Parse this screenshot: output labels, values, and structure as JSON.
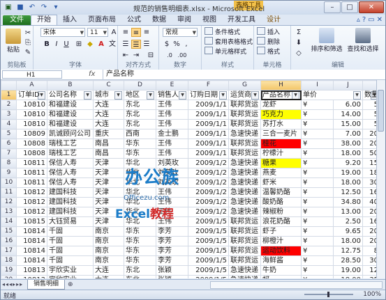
{
  "window": {
    "title": "规范的销售明细表.xlsx - Microsoft Excel",
    "context_tab_group": "表格工具"
  },
  "ribbon_tabs": [
    "文件",
    "开始",
    "插入",
    "页面布局",
    "公式",
    "数据",
    "审阅",
    "视图",
    "开发工具",
    "设计"
  ],
  "ribbon": {
    "clipboard": {
      "paste": "粘贴",
      "group": "剪贴板"
    },
    "font": {
      "name": "宋体",
      "size": "11",
      "group": "字体"
    },
    "alignment": {
      "group": "对齐方式"
    },
    "number": {
      "format": "常规",
      "group": "数字"
    },
    "styles": {
      "cond": "条件格式",
      "table": "套用表格格式",
      "cell": "单元格样式",
      "group": "样式"
    },
    "cells": {
      "insert": "插入",
      "delete": "删除",
      "format": "格式",
      "group": "单元格"
    },
    "editing": {
      "sort": "排序和筛选",
      "find": "查找和选择",
      "group": "编辑"
    }
  },
  "formula_bar": {
    "name_box": "H1",
    "fx": "fx",
    "content": "产品名称"
  },
  "columns": [
    "A",
    "B",
    "C",
    "D",
    "E",
    "F",
    "G",
    "H",
    "I",
    "J"
  ],
  "headers": [
    "订单ID",
    "公司名称",
    "城市",
    "地区",
    "销售人",
    "订购日期",
    "运货商",
    "产品名称",
    "单价",
    "数量"
  ],
  "rows": [
    [
      "10810",
      "和福建设",
      "大连",
      "东北",
      "王伟",
      "2009/1/1",
      "联邦货运",
      "龙虾",
      "¥",
      "6.00",
      "5",
      ""
    ],
    [
      "10810",
      "和福建设",
      "大连",
      "东北",
      "王伟",
      "2009/1/1",
      "联邦货运",
      "巧克力",
      "¥",
      "14.00",
      "5",
      "yellow"
    ],
    [
      "10810",
      "和福建设",
      "大连",
      "东北",
      "王伟",
      "2009/1/1",
      "联邦货运",
      "苏打水",
      "¥",
      "15.00",
      "5",
      ""
    ],
    [
      "10809",
      "凯诚顾问公司",
      "重庆",
      "西南",
      "金士鹏",
      "2009/1/1",
      "急速快递",
      "三合一麦片",
      "¥",
      "7.00",
      "20",
      ""
    ],
    [
      "10808",
      "瑞栈工艺",
      "南昌",
      "华东",
      "王伟",
      "2009/1/1",
      "联邦货运",
      "桂花",
      "¥",
      "38.00",
      "20",
      "red"
    ],
    [
      "10808",
      "瑞栈工艺",
      "南昌",
      "华东",
      "王伟",
      "2009/1/1",
      "联邦货运",
      "柠檬汁",
      "¥",
      "18.00",
      "50",
      ""
    ],
    [
      "10811",
      "保信人寿",
      "天津",
      "华北",
      "刘英玫",
      "2009/1/2",
      "急速快递",
      "糖果",
      "¥",
      "9.20",
      "15",
      "yellow"
    ],
    [
      "10811",
      "保信人寿",
      "天津",
      "华北",
      "刘英玫",
      "2009/1/2",
      "急速快递",
      "燕麦",
      "¥",
      "19.00",
      "18",
      ""
    ],
    [
      "10811",
      "保信人寿",
      "天津",
      "华北",
      "刘英玫",
      "2009/1/2",
      "急速快递",
      "虾米",
      "¥",
      "18.00",
      "30",
      ""
    ],
    [
      "10812",
      "建国科技",
      "天津",
      "华北",
      "王伟",
      "2009/1/2",
      "急速快递",
      "温馨奶酪",
      "¥",
      "12.50",
      "16",
      ""
    ],
    [
      "10812",
      "建国科技",
      "天津",
      "华北",
      "王伟",
      "2009/1/2",
      "急速快递",
      "酸奶酪",
      "¥",
      "34.80",
      "40",
      ""
    ],
    [
      "10812",
      "建国科技",
      "天津",
      "华北",
      "王伟",
      "2009/1/2",
      "急速快递",
      "辣椒粉",
      "¥",
      "13.00",
      "20",
      ""
    ],
    [
      "10815",
      "大钰贸易",
      "天津",
      "华北",
      "王伟",
      "2009/1/5",
      "联邦货运",
      "浪花奶酪",
      "¥",
      "2.50",
      "16",
      ""
    ],
    [
      "10814",
      "千固",
      "南京",
      "华东",
      "李芳",
      "2009/1/5",
      "联邦货运",
      "虾子",
      "¥",
      "9.65",
      "20",
      ""
    ],
    [
      "10814",
      "千固",
      "南京",
      "华东",
      "李芳",
      "2009/1/5",
      "联邦货运",
      "柳橙汁",
      "¥",
      "18.00",
      "20",
      ""
    ],
    [
      "10814",
      "千固",
      "南京",
      "华东",
      "李芳",
      "2009/1/5",
      "联邦货运",
      "运动饮料",
      "¥",
      "12.75",
      "8",
      "red"
    ],
    [
      "10814",
      "千固",
      "南京",
      "华东",
      "李芳",
      "2009/1/5",
      "联邦货运",
      "海鲜酱",
      "¥",
      "28.50",
      "30",
      ""
    ],
    [
      "10813",
      "宇欣实业",
      "大连",
      "东北",
      "张颖",
      "2009/1/5",
      "急速快递",
      "牛奶",
      "¥",
      "19.00",
      "12",
      ""
    ],
    [
      "10813",
      "宇欣实业",
      "大连",
      "东北",
      "张颖",
      "2009/1/5",
      "急速快递",
      "蚵",
      "¥",
      "18.00",
      "35",
      ""
    ]
  ],
  "watermark": {
    "line1": "办公族",
    "line2": "Officezu.com",
    "line3a": "Excel",
    "line3b": "教程"
  },
  "sheet_tabs": [
    "销售明细"
  ],
  "status": {
    "ready": "就绪",
    "zoom": "100%"
  }
}
